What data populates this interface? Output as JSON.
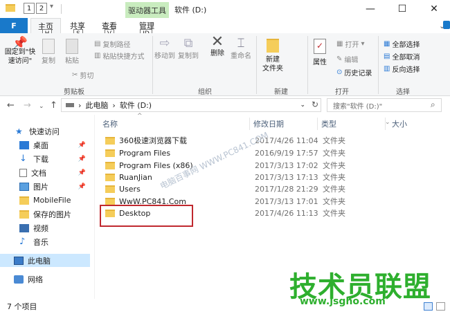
{
  "window": {
    "title": "软件 (D:)",
    "contextual_tab": "驱动器工具",
    "qa_keytips": [
      "1",
      "2"
    ],
    "controls": {
      "minimize": "—",
      "maximize": "☐",
      "close": "✕"
    }
  },
  "tabs": [
    {
      "label": "F",
      "keytip": ""
    },
    {
      "label": "主页",
      "keytip": "H"
    },
    {
      "label": "共享",
      "keytip": "S"
    },
    {
      "label": "查看",
      "keytip": "V"
    },
    {
      "label": "管理",
      "keytip": "JD"
    }
  ],
  "ribbon": {
    "clipboard": {
      "group": "剪贴板",
      "pin": "固定到\"快\n速访问\"",
      "copy": "复制",
      "paste": "粘贴",
      "cut": "剪切",
      "copy_path": "复制路径",
      "paste_shortcut": "粘贴快捷方式"
    },
    "organize": {
      "group": "组织",
      "move_to": "移动到",
      "copy_to": "复制到",
      "delete": "删除",
      "rename": "重命名"
    },
    "new": {
      "group": "新建",
      "new_folder": "新建\n文件夹"
    },
    "open": {
      "group": "打开",
      "properties": "属性",
      "open": "打开",
      "edit": "编辑",
      "history": "历史记录"
    },
    "select": {
      "group": "选择",
      "select_all": "全部选择",
      "select_none": "全部取消",
      "invert": "反向选择"
    }
  },
  "address": {
    "path": [
      "此电脑",
      "软件 (D:)"
    ],
    "search_placeholder": "搜索\"软件 (D:)\""
  },
  "nav": {
    "items": [
      {
        "label": "快速访问",
        "icon": "star-icon",
        "pinned": false
      },
      {
        "label": "桌面",
        "icon": "desktop-icon",
        "pinned": true
      },
      {
        "label": "下载",
        "icon": "download-icon",
        "pinned": true
      },
      {
        "label": "文档",
        "icon": "document-icon",
        "pinned": true
      },
      {
        "label": "图片",
        "icon": "picture-icon",
        "pinned": true
      },
      {
        "label": "MobileFile",
        "icon": "folder-icon",
        "pinned": false
      },
      {
        "label": "保存的图片",
        "icon": "folder-icon",
        "pinned": false
      },
      {
        "label": "视频",
        "icon": "video-icon",
        "pinned": false
      },
      {
        "label": "音乐",
        "icon": "music-icon",
        "pinned": false
      },
      {
        "label": "此电脑",
        "icon": "computer-icon",
        "pinned": false
      },
      {
        "label": "网络",
        "icon": "network-icon",
        "pinned": false
      }
    ],
    "pin_glyph": "📌"
  },
  "columns": {
    "name": "名称",
    "date": "修改日期",
    "type": "类型",
    "size": "大小"
  },
  "files": [
    {
      "name": "360极速浏览器下载",
      "date": "2017/4/26 11:04",
      "type": "文件夹"
    },
    {
      "name": "Program Files",
      "date": "2016/9/19 17:57",
      "type": "文件夹"
    },
    {
      "name": "Program Files (x86)",
      "date": "2017/3/13 17:02",
      "type": "文件夹"
    },
    {
      "name": "RuanJian",
      "date": "2017/3/13 17:13",
      "type": "文件夹"
    },
    {
      "name": "Users",
      "date": "2017/1/28 21:29",
      "type": "文件夹"
    },
    {
      "name": "WwW.PC841.Com",
      "date": "2017/3/13 17:01",
      "type": "文件夹"
    },
    {
      "name": "Desktop",
      "date": "2017/4/26 11:13",
      "type": "文件夹"
    }
  ],
  "status": {
    "count": "7 个项目"
  },
  "watermark": "电脑百事网 WWW.PC841.COM",
  "brand": {
    "name": "技术员联盟",
    "url": "www.jsgho.com"
  },
  "colors": {
    "accent": "#1979ca",
    "tool_tab": "#c9ecbf",
    "highlight": "#c0282e",
    "brand": "#2eaf2e",
    "folder": "#f5cd5a"
  }
}
